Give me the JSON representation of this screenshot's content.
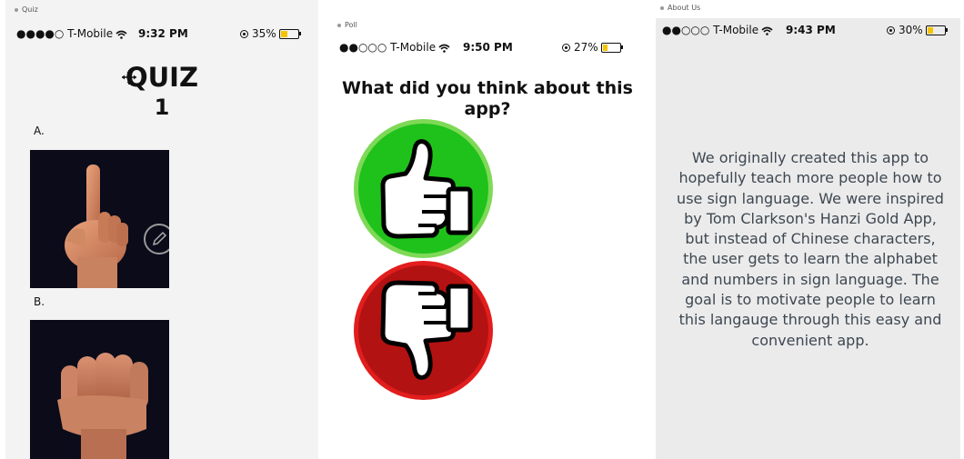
{
  "screens": {
    "quiz": {
      "tab_caption": "Quiz",
      "status": {
        "signal": "●●●●○ T-Mobile",
        "time": "9:32 PM",
        "battery": "35%",
        "battery_level": 0.35
      },
      "title_line1": "QUIZ",
      "title_line2": "1",
      "options": [
        {
          "label": "A.",
          "image_icon": "hand-sign-one-icon"
        },
        {
          "label": "B.",
          "image_icon": "hand-sign-a-fist-icon"
        }
      ],
      "edit_icon": "pencil-icon"
    },
    "poll": {
      "tab_caption": "Poll",
      "status": {
        "signal": "●●○○○ T-Mobile",
        "time": "9:50 PM",
        "battery": "27%",
        "battery_level": 0.27
      },
      "question": "What did you think about this app?",
      "like_icon": "thumbs-up-icon",
      "dislike_icon": "thumbs-down-icon",
      "colors": {
        "like": "#1fc21a",
        "like_ring": "#7ed957",
        "dislike": "#b31212",
        "dislike_ring": "#e21d1d"
      }
    },
    "about": {
      "tab_caption": "About Us",
      "status": {
        "signal": "●●○○○ T-Mobile",
        "time": "9:43 PM",
        "battery": "30%",
        "battery_level": 0.3
      },
      "body": "We originally created this app to hopefully teach more people how to use sign language. We were inspired by Tom Clarkson's Hanzi Gold App, but instead of Chinese characters, the user gets to learn the alphabet and numbers in sign language. The goal is to motivate people to learn this langauge through this easy and convenient app."
    }
  }
}
